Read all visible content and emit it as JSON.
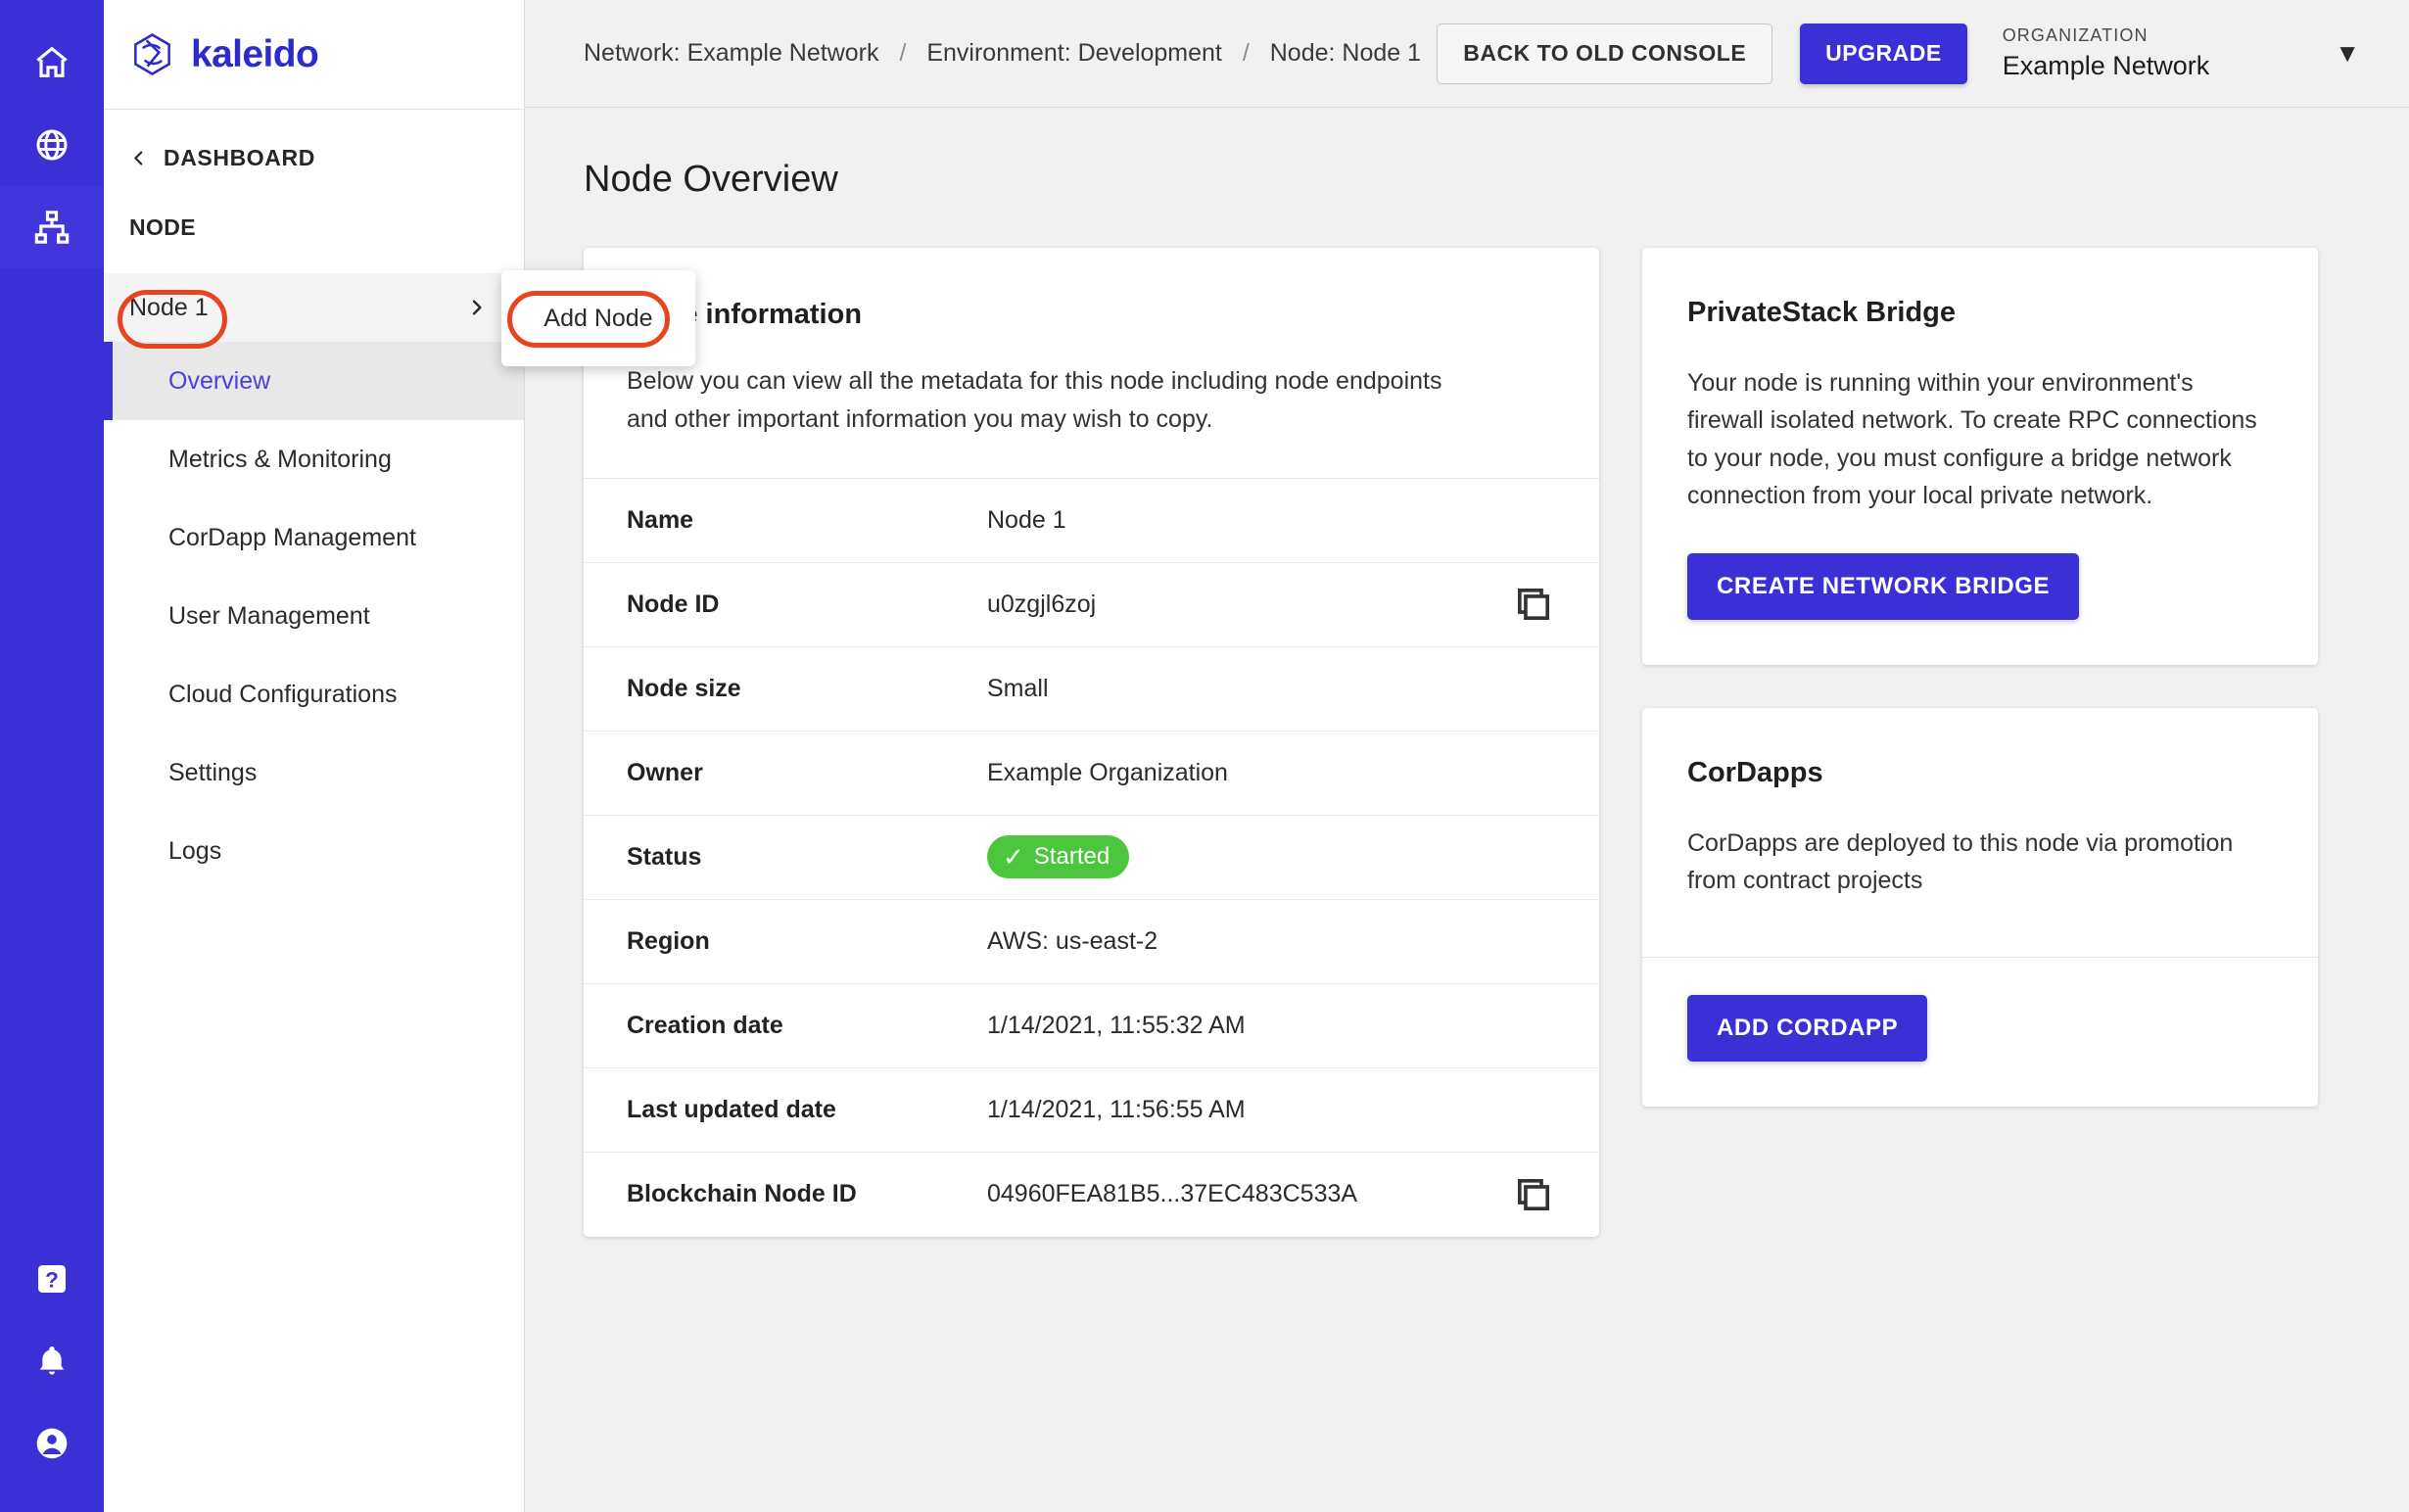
{
  "rail": {
    "top_items": [
      {
        "name": "home-icon",
        "label": "Home"
      },
      {
        "name": "globe-icon",
        "label": "Networks"
      },
      {
        "name": "sitemap-icon",
        "label": "Environments"
      }
    ],
    "bottom_items": [
      {
        "name": "help-icon",
        "label": "Help"
      },
      {
        "name": "bell-icon",
        "label": "Notifications"
      },
      {
        "name": "account-icon",
        "label": "Account"
      }
    ]
  },
  "sidebar": {
    "brand": "kaleido",
    "back_label": "DASHBOARD",
    "section_label": "NODE",
    "node_row": {
      "label": "Node 1",
      "icon": "chevron-right-icon"
    },
    "items": [
      {
        "label": "Overview",
        "active": true
      },
      {
        "label": "Metrics & Monitoring",
        "active": false
      },
      {
        "label": "CorDapp Management",
        "active": false
      },
      {
        "label": "User Management",
        "active": false
      },
      {
        "label": "Cloud Configurations",
        "active": false
      },
      {
        "label": "Settings",
        "active": false
      },
      {
        "label": "Logs",
        "active": false
      }
    ]
  },
  "topbar": {
    "breadcrumb": [
      "Network: Example Network",
      "Environment: Development",
      "Node: Node 1"
    ],
    "separator": "/",
    "back_console_label": "BACK TO OLD CONSOLE",
    "upgrade_label": "UPGRADE",
    "organization_label": "ORGANIZATION",
    "organization_name": "Example Network",
    "caret": "▼"
  },
  "page": {
    "title": "Node Overview"
  },
  "info_card": {
    "title": "Node information",
    "description": "Below you can view all the metadata for this node including node endpoints and other important information you may wish to copy.",
    "rows": [
      {
        "key": "Name",
        "value": "Node 1",
        "copy": false,
        "pill": false
      },
      {
        "key": "Node ID",
        "value": "u0zgjl6zoj",
        "copy": true,
        "pill": false
      },
      {
        "key": "Node size",
        "value": "Small",
        "copy": false,
        "pill": false
      },
      {
        "key": "Owner",
        "value": "Example Organization",
        "copy": false,
        "pill": false
      },
      {
        "key": "Status",
        "value": "Started",
        "copy": false,
        "pill": true
      },
      {
        "key": "Region",
        "value": "AWS: us-east-2",
        "copy": false,
        "pill": false
      },
      {
        "key": "Creation date",
        "value": "1/14/2021, 11:55:32 AM",
        "copy": false,
        "pill": false
      },
      {
        "key": "Last updated date",
        "value": "1/14/2021, 11:56:55 AM",
        "copy": false,
        "pill": false
      },
      {
        "key": "Blockchain Node ID",
        "value": "04960FEA81B5...37EC483C533A",
        "copy": true,
        "pill": false
      }
    ]
  },
  "bridge_card": {
    "title": "PrivateStack Bridge",
    "text": "Your node is running within your environment's firewall isolated network. To create RPC connections to your node, you must configure a bridge network connection from your local private network.",
    "button_label": "CREATE NETWORK BRIDGE"
  },
  "cordapps_card": {
    "title": "CorDapps",
    "text": "CorDapps are deployed to this node via promotion from contract projects",
    "button_label": "ADD CORDAPP"
  },
  "popup": {
    "item_label": "Add Node"
  },
  "colors": {
    "brand_indigo": "#3a30d6",
    "annotation_red": "#E8441F",
    "status_green": "#4CC63C",
    "page_bg": "#f1f1f1"
  }
}
